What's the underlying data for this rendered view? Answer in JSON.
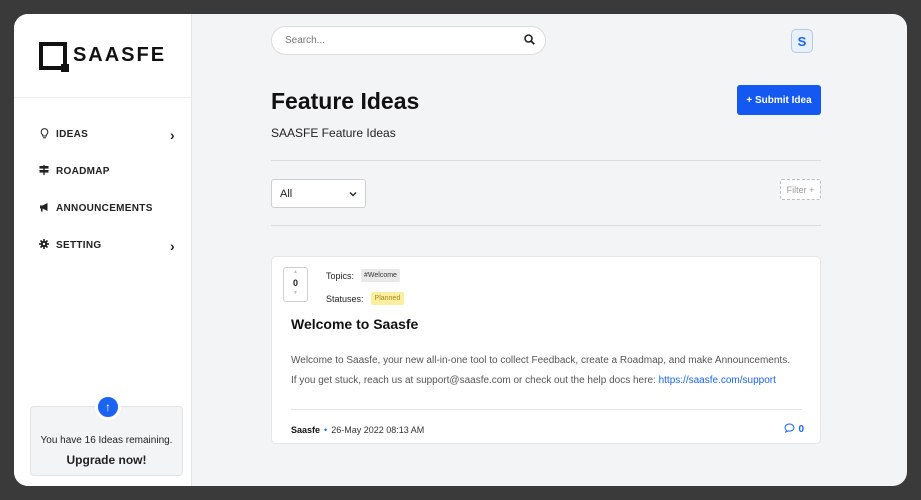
{
  "brand": {
    "name": "SAASFE"
  },
  "sidebar": {
    "items": [
      {
        "label": "IDEAS",
        "icon": "lightbulb-icon",
        "has_children": true
      },
      {
        "label": "ROADMAP",
        "icon": "signpost-icon",
        "has_children": false
      },
      {
        "label": "ANNOUNCEMENTS",
        "icon": "megaphone-icon",
        "has_children": false
      },
      {
        "label": "SETTING",
        "icon": "gear-icon",
        "has_children": true
      }
    ],
    "upgrade": {
      "message": "You have 16 Ideas remaining.",
      "cta": "Upgrade now!"
    }
  },
  "header": {
    "search_placeholder": "Search...",
    "avatar_letter": "S"
  },
  "page": {
    "title": "Feature Ideas",
    "subtitle": "SAASFE Feature Ideas",
    "submit_label": "+ Submit Idea",
    "filter_select_value": "All",
    "filter_button_label": "Filter +"
  },
  "ideas": [
    {
      "votes": "0",
      "topics_label": "Topics:",
      "topic": "#Welcome",
      "statuses_label": "Statuses:",
      "status": "Planned",
      "title": "Welcome to Saasfe",
      "body_line1": "Welcome to Saasfe, your new all-in-one tool to collect Feedback, create a Roadmap, and make Announcements.",
      "body_line2_prefix": "If you get stuck, reach us at support@saasfe.com or check out the help docs here: ",
      "body_link": "https://saasfe.com/support",
      "author": "Saasfe",
      "date": "26-May 2022 08:13 AM",
      "comments": "0"
    }
  ],
  "colors": {
    "accent": "#1358f0",
    "status_planned_bg": "#fbeea0",
    "background": "#f3f4f6"
  }
}
